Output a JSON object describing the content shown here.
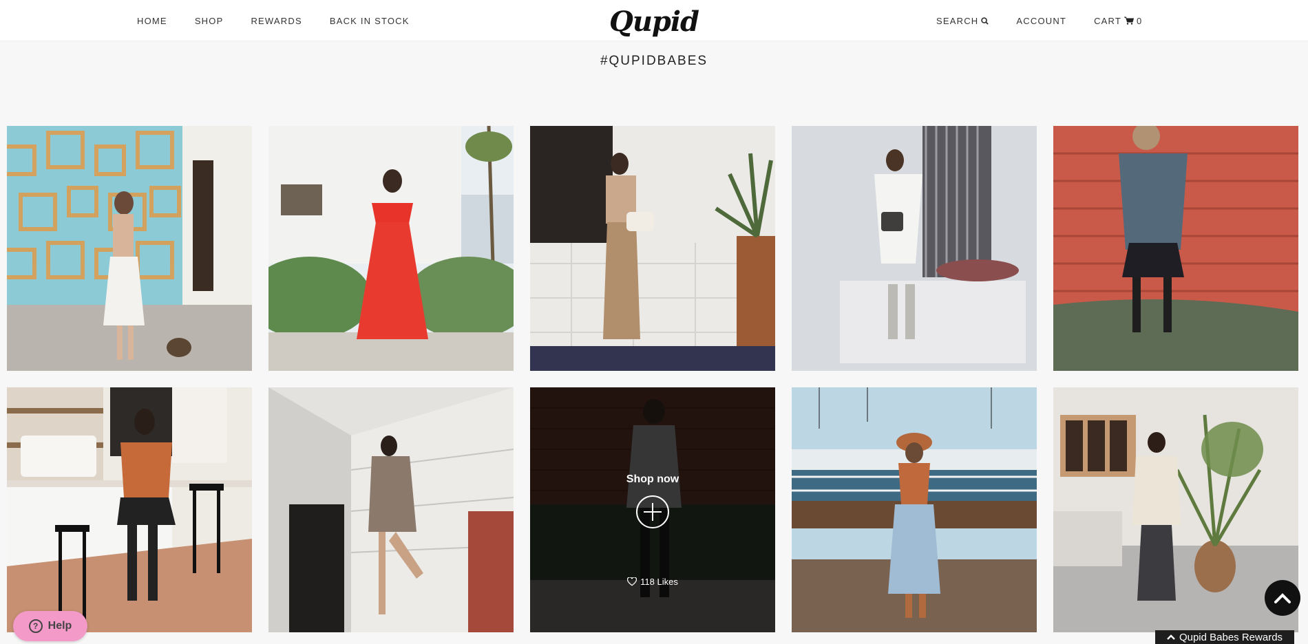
{
  "header": {
    "nav_left": [
      "HOME",
      "SHOP",
      "REWARDS",
      "BACK IN STOCK"
    ],
    "logo_text": "Qupid",
    "search_label": "SEARCH",
    "account_label": "ACCOUNT",
    "cart_label": "CART",
    "cart_count": "0"
  },
  "page": {
    "heading": "#QUPIDBABES"
  },
  "gallery": {
    "overlay_tile_index": 7,
    "shop_now_label": "Shop now",
    "likes_label": "118 Likes"
  },
  "widgets": {
    "help_label": "Help",
    "rewards_label": "Qupid Babes Rewards"
  },
  "colors": {
    "help_button": "#f39ac9",
    "rewards_tab": "#1e1e1e",
    "background": "#f7f7f7"
  }
}
